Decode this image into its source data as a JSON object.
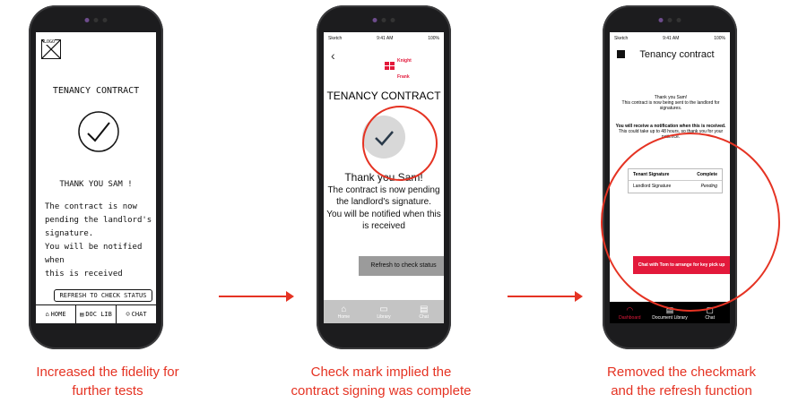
{
  "sketch": {
    "logo": "LOGO",
    "title": "TENANCY CONTRACT",
    "thanks": "THANK YOU SAM !",
    "body": [
      "The contract is now",
      "pending the landlord's",
      "signature.",
      "You will be notified when",
      "this is received"
    ],
    "refresh": "REFRESH TO CHECK STATUS",
    "nav": [
      "HOME",
      "DOC LIB",
      "CHAT"
    ]
  },
  "mid": {
    "status": {
      "carrier": "Sketch",
      "time": "9:41 AM",
      "battery": "100%"
    },
    "logo_lines": [
      "Knight",
      "Frank"
    ],
    "title": "TENANCY CONTRACT",
    "thanks": "Thank you Sam!",
    "lines": [
      "The contract is now pending",
      "the landlord's signature.",
      "You will be notified when this",
      "is received"
    ],
    "refresh": "Refresh to check status",
    "nav": [
      "Home",
      "Library",
      "Chat"
    ]
  },
  "right": {
    "status": {
      "carrier": "Sketch",
      "time": "9:41 AM",
      "battery": "100%"
    },
    "title": "Tenancy contract",
    "thanks": "Thank you Sam!",
    "sending": "This contract is now being sent to the landlord for signatures.",
    "notify_bold": "You will receive a notification when this is received.",
    "notify": "This could take up to 48 hours, so thank you for your patience.",
    "table": {
      "rows": [
        {
          "label": "Tenant Signature",
          "status": "Complete"
        },
        {
          "label": "Landlord Signature",
          "status": "Pending"
        }
      ]
    },
    "chat_button": "Chat with Tom to arrange for key pick up",
    "nav": [
      "Dashboard",
      "Document Library",
      "Chat"
    ]
  },
  "captions": [
    [
      "Increased the fidelity for",
      "further tests"
    ],
    [
      "Check mark implied the",
      "contract signing was complete"
    ],
    [
      "Removed the checkmark",
      "and the refresh function"
    ]
  ],
  "colors": {
    "annotation": "#e53323",
    "brand": "#e3193b"
  }
}
